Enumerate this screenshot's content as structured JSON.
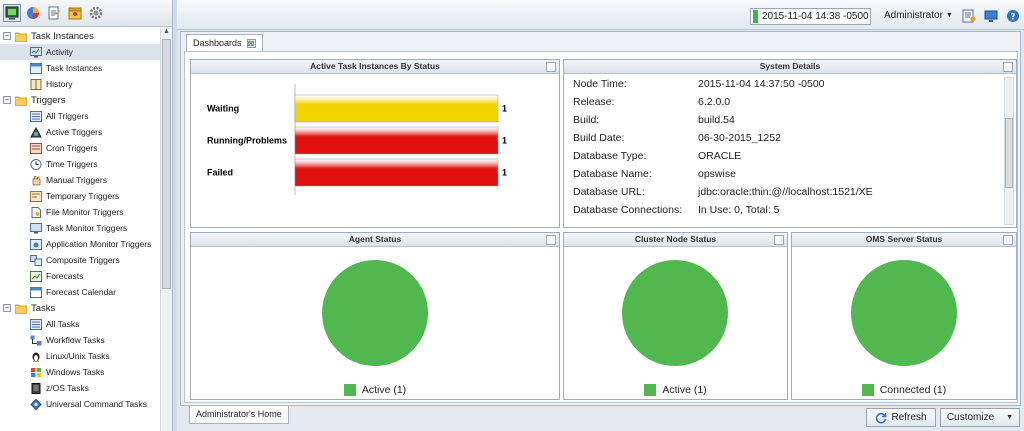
{
  "toolbar": {
    "buttons": [
      "monitor-icon",
      "pie-chart-icon",
      "report-icon",
      "bundle-icon",
      "gear-icon"
    ]
  },
  "tree": {
    "groups": [
      {
        "label": "Task Instances",
        "expander": "−",
        "items": [
          "Activity",
          "Task Instances",
          "History"
        ]
      },
      {
        "label": "Triggers",
        "expander": "−",
        "items": [
          "All Triggers",
          "Active Triggers",
          "Cron Triggers",
          "Time Triggers",
          "Manual Triggers",
          "Temporary Triggers",
          "File Monitor Triggers",
          "Task Monitor Triggers",
          "Application Monitor Triggers",
          "Composite Triggers",
          "Forecasts",
          "Forecast Calendar"
        ]
      },
      {
        "label": "Tasks",
        "expander": "−",
        "items": [
          "All Tasks",
          "Workflow Tasks",
          "Linux/Unix Tasks",
          "Windows Tasks",
          "z/OS Tasks",
          "Universal Command Tasks"
        ]
      }
    ]
  },
  "header": {
    "datetime": "2015-11-04 14:38 -0500",
    "user": "Administrator",
    "colors": {
      "status": "#3cb44a"
    }
  },
  "dashboard": {
    "tab_label": "Dashboards",
    "tab_close": "⊠",
    "active_tasks": {
      "title": "Active Task Instances By Status",
      "chart_data": {
        "type": "bar",
        "orientation": "horizontal",
        "title": "Active Task Instances By Status",
        "categories": [
          "Waiting",
          "Running/Problems",
          "Failed"
        ],
        "values": [
          1,
          1,
          1
        ],
        "colors": [
          "#f4d400",
          "#e01010",
          "#e01010"
        ],
        "xlim": [
          0,
          1
        ],
        "grid": false
      }
    },
    "system_details": {
      "title": "System Details",
      "rows": [
        {
          "key": "Node Time:",
          "value": "2015-11-04 14:37:50 -0500"
        },
        {
          "key": "Release:",
          "value": "6.2.0.0"
        },
        {
          "key": "Build:",
          "value": "build.54"
        },
        {
          "key": "Build Date:",
          "value": "06-30-2015_1252"
        },
        {
          "key": "Database Type:",
          "value": "ORACLE"
        },
        {
          "key": "Database Name:",
          "value": "opswise"
        },
        {
          "key": "Database URL:",
          "value": "jdbc:oracle:thin:@//localhost:1521/XE"
        },
        {
          "key": "Database Connections:",
          "value": "In Use: 0, Total: 5"
        }
      ]
    },
    "agent_status": {
      "title": "Agent Status",
      "chart_data": {
        "type": "pie",
        "title": "Agent Status",
        "categories": [
          "Active"
        ],
        "values": [
          1
        ],
        "labels": [
          "Active (1)"
        ],
        "colors": [
          "#51b74f"
        ]
      }
    },
    "cluster_status": {
      "title": "Cluster Node Status",
      "chart_data": {
        "type": "pie",
        "title": "Cluster Node Status",
        "categories": [
          "Active"
        ],
        "values": [
          1
        ],
        "labels": [
          "Active (1)"
        ],
        "colors": [
          "#51b74f"
        ]
      }
    },
    "oms_status": {
      "title": "OMS Server Status",
      "chart_data": {
        "type": "pie",
        "title": "OMS Server Status",
        "categories": [
          "Connected"
        ],
        "values": [
          1
        ],
        "labels": [
          "Connected (1)"
        ],
        "colors": [
          "#51b74f"
        ]
      }
    }
  },
  "footer": {
    "home_tab": "Administrator's Home",
    "refresh_label": "Refresh",
    "customize_label": "Customize"
  }
}
